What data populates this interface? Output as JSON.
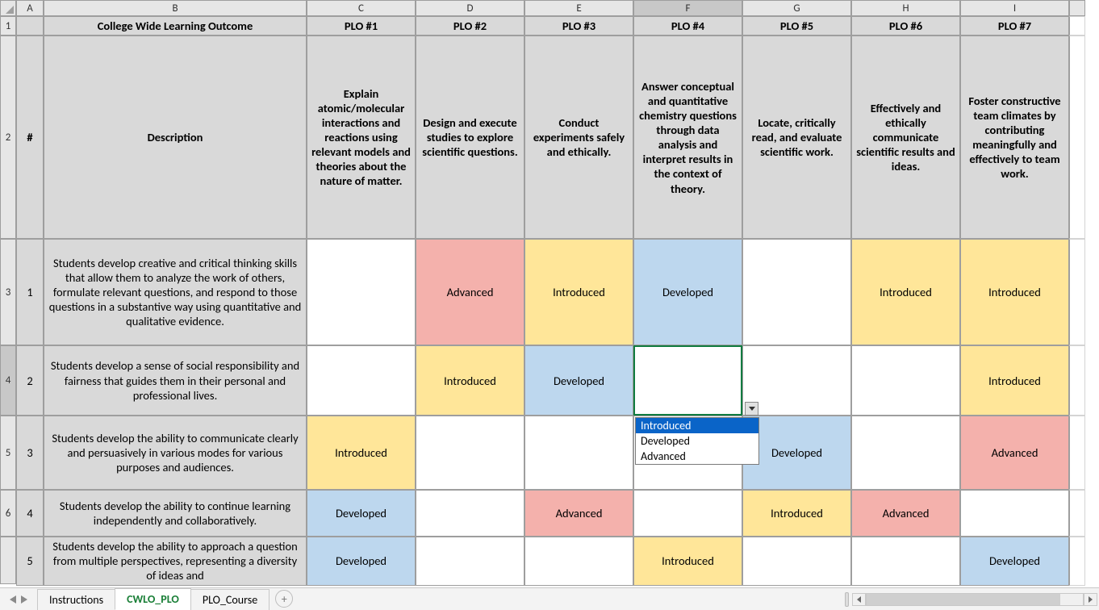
{
  "columns": {
    "corner": "",
    "A": "A",
    "B": "B",
    "C": "C",
    "D": "D",
    "E": "E",
    "F": "F",
    "G": "G",
    "H": "H",
    "I": "I",
    "blank": ""
  },
  "row_headers": {
    "r1": "1",
    "r2": "2",
    "r3": "3",
    "r4": "4",
    "r5": "5",
    "r6": "6",
    "r7": ""
  },
  "header_row": {
    "a": "",
    "b": "College Wide Learning Outcome",
    "c": "PLO #1",
    "d": "PLO #2",
    "e": "PLO #3",
    "f": "PLO #4",
    "g": "PLO #5",
    "h": "PLO #6",
    "i": "PLO #7"
  },
  "desc_row": {
    "a": "#",
    "b": "Description",
    "c": "Explain atomic/molecular interactions and reactions using relevant models and theories about the nature of matter.",
    "d": "Design and execute studies to explore scientific questions.",
    "e": "Conduct experiments safely and ethically.",
    "f": "Answer conceptual and quantitative chemistry questions through data analysis and interpret results in the context of theory.",
    "g": "Locate, critically read, and evaluate scientific work.",
    "h": "Effectively and ethically communicate scientific results and ideas.",
    "i": "Foster constructive team climates by contributing meaningfully and effectively to team work."
  },
  "rows": {
    "r1": {
      "num": "1",
      "desc": "Students develop creative and critical thinking skills that allow them to analyze the work of others, formulate relevant questions, and respond to those questions in a substantive way using quantitative and qualitative evidence.",
      "c": "",
      "d": "Advanced",
      "e": "Introduced",
      "f": "Developed",
      "g": "",
      "h": "Introduced",
      "i": "Introduced"
    },
    "r2": {
      "num": "2",
      "desc": "Students develop a sense of social responsibility and fairness that guides them in their personal and professional lives.",
      "c": "",
      "d": "Introduced",
      "e": "Developed",
      "f": "",
      "g": "",
      "h": "",
      "i": "Introduced"
    },
    "r3": {
      "num": "3",
      "desc": "Students develop the ability to communicate clearly and persuasively in various modes for various purposes and audiences.",
      "c": "Introduced",
      "d": "",
      "e": "",
      "f": "",
      "g": "Developed",
      "h": "",
      "i": "Advanced"
    },
    "r4": {
      "num": "4",
      "desc": "Students develop the ability to continue learning independently and collaboratively.",
      "c": "Developed",
      "d": "",
      "e": "Advanced",
      "f": "",
      "g": "Introduced",
      "h": "Advanced",
      "i": ""
    },
    "r5": {
      "num": "5",
      "desc": "Students develop the ability to approach a question from multiple perspectives, representing a diversity of ideas and",
      "c": "Developed",
      "d": "",
      "e": "",
      "f": "Introduced",
      "g": "",
      "h": "",
      "i": "Developed"
    }
  },
  "dropdown": {
    "opt1": "Introduced",
    "opt2": "Developed",
    "opt3": "Advanced"
  },
  "tabs": {
    "t1": "Instructions",
    "t2": "CWLO_PLO",
    "t3": "PLO_Course",
    "add": "+"
  },
  "selected_column": "F",
  "selected_row": "4",
  "selected_cell": "F4",
  "colors": {
    "yellow": "#ffe699",
    "blue": "#bdd7ee",
    "red": "#f4b1ac",
    "header_gray": "#d9d9d9",
    "sel_green": "#107c41"
  }
}
